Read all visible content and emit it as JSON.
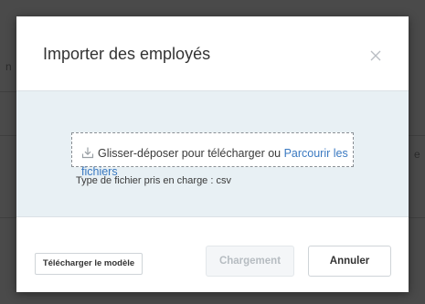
{
  "dialog": {
    "title": "Importer des employés",
    "close_icon": "close-icon"
  },
  "dropzone": {
    "icon": "upload-icon",
    "text": "Glisser-déposer pour télécharger ou ",
    "browse_label": "Parcourir les fichiers"
  },
  "filetype_note": "Type de fichier pris en charge : csv",
  "footer": {
    "download_template_label": "Télécharger le modèle",
    "load_label": "Chargement",
    "cancel_label": "Annuler"
  },
  "colors": {
    "link": "#3a79c1",
    "body_background": "#e8f0f4",
    "overlay": "#4a4a4a"
  }
}
